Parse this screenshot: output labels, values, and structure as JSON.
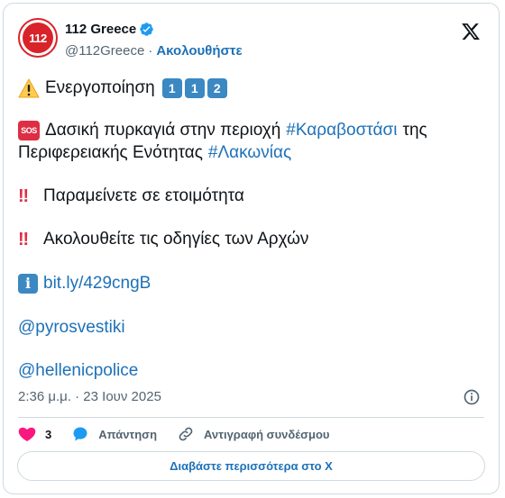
{
  "author": {
    "display_name": "112 Greece",
    "handle": "@112Greece",
    "follow_label": "Ακολουθήστε",
    "avatar_text": "112"
  },
  "icons": {
    "verified": "verified-badge-icon",
    "x_logo": "x-logo-icon",
    "warning": "warning-emoji",
    "keycap_1": "keycap-1-emoji",
    "keycap_2": "keycap-2-emoji",
    "sos": "sos-emoji",
    "double_exclamation": "double-exclamation-emoji",
    "info": "information-emoji",
    "heart": "heart-icon",
    "reply": "reply-bubble-icon",
    "link": "link-icon",
    "info_circle": "info-circle-icon"
  },
  "tweet": {
    "line1_text": "Ενεργοποίηση",
    "keycaps": [
      "1",
      "1",
      "2"
    ],
    "sos_label": "SOS",
    "line2_text": "Δασική πυρκαγιά στην περιοχή",
    "hashtag1": "#Καραβοστάσι",
    "line2_after": "της",
    "line3_text": "Περιφερειακής Ενότητας",
    "hashtag2": "#Λακωνίας",
    "bang": "‼",
    "line4_text": "Παραμείνετε σε ετοιμότητα",
    "line5_text": "Ακολουθείτε τις οδηγίες των Αρχών",
    "info_label": "i",
    "link_text": "bit.ly/429cngB",
    "mention1": "@pyrosvestiki",
    "mention2": "@hellenicpolice"
  },
  "meta": {
    "timestamp": "2:36 μ.μ. · 23 Ιουν 2025"
  },
  "actions": {
    "like_count": "3",
    "reply_label": "Απάντηση",
    "copy_link_label": "Αντιγραφή συνδέσμου"
  },
  "read_more_label": "Διαβάστε περισσότερα στο X",
  "colors": {
    "accent": "#1d71b8",
    "brand_red": "#d8232a",
    "muted": "#536471",
    "border": "#cfd9de",
    "heart": "#f91880",
    "verified": "#1d9bf0"
  }
}
